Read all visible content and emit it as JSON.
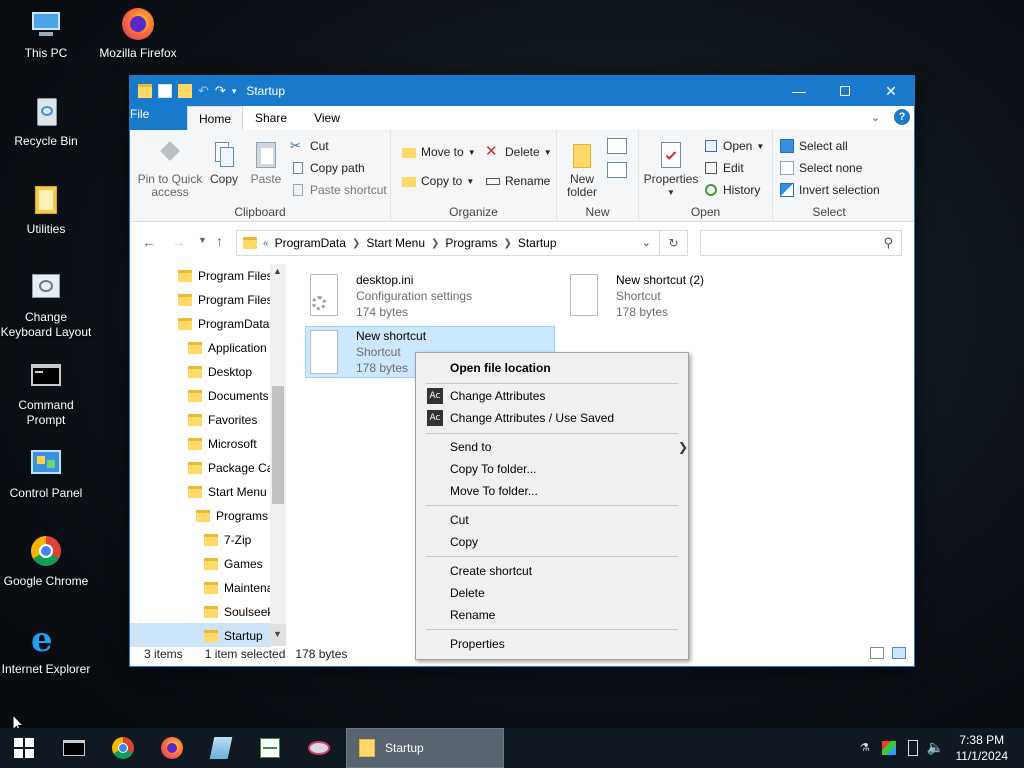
{
  "desktop": {
    "icons": [
      {
        "label": "This PC",
        "icon": "computer-icon"
      },
      {
        "label": "Mozilla Firefox",
        "icon": "firefox-icon"
      },
      {
        "label": "Recycle Bin",
        "icon": "recycle-bin-icon"
      },
      {
        "label": "Utilities",
        "icon": "folder-icon"
      },
      {
        "label": "Change Keyboard Layout",
        "icon": "keyboard-icon"
      },
      {
        "label": "Command Prompt",
        "icon": "terminal-icon"
      },
      {
        "label": "Control Panel",
        "icon": "control-panel-icon"
      },
      {
        "label": "Google Chrome",
        "icon": "chrome-icon"
      },
      {
        "label": "Internet Explorer",
        "icon": "ie-icon"
      }
    ]
  },
  "window": {
    "title": "Startup",
    "tabs": [
      "File",
      "Home",
      "Share",
      "View"
    ],
    "ribbon": {
      "clipboard": {
        "pin": "Pin to Quick access",
        "copy": "Copy",
        "paste": "Paste",
        "cut": "Cut",
        "copy_path": "Copy path",
        "paste_shortcut": "Paste shortcut",
        "label": "Clipboard"
      },
      "organize": {
        "move_to": "Move to",
        "copy_to": "Copy to",
        "delete": "Delete",
        "rename": "Rename",
        "label": "Organize"
      },
      "new": {
        "new_folder": "New folder",
        "label": "New"
      },
      "open": {
        "properties": "Properties",
        "open": "Open",
        "edit": "Edit",
        "history": "History",
        "label": "Open"
      },
      "select": {
        "select_all": "Select all",
        "select_none": "Select none",
        "invert": "Invert selection",
        "label": "Select"
      }
    },
    "address": {
      "prefix": "«",
      "crumbs": [
        "ProgramData",
        "Start Menu",
        "Programs",
        "Startup"
      ]
    },
    "nav": [
      {
        "label": "Program Files",
        "indent": 0
      },
      {
        "label": "Program Files",
        "indent": 0
      },
      {
        "label": "ProgramData",
        "indent": 0
      },
      {
        "label": "Application",
        "indent": 1
      },
      {
        "label": "Desktop",
        "indent": 1
      },
      {
        "label": "Documents",
        "indent": 1
      },
      {
        "label": "Favorites",
        "indent": 1
      },
      {
        "label": "Microsoft",
        "indent": 1
      },
      {
        "label": "Package Ca",
        "indent": 1
      },
      {
        "label": "Start Menu",
        "indent": 1
      },
      {
        "label": "Programs",
        "indent": 2
      },
      {
        "label": "7-Zip",
        "indent": 3
      },
      {
        "label": "Games",
        "indent": 3
      },
      {
        "label": "Maintena",
        "indent": 3
      },
      {
        "label": "Soulseek",
        "indent": 3
      },
      {
        "label": "Startup",
        "indent": 3
      }
    ],
    "files": [
      {
        "name": "desktop.ini",
        "type": "Configuration settings",
        "size": "174 bytes"
      },
      {
        "name": "New shortcut (2)",
        "type": "Shortcut",
        "size": "178 bytes"
      },
      {
        "name": "New shortcut",
        "type": "Shortcut",
        "size": "178 bytes"
      }
    ],
    "status": {
      "count": "3 items",
      "selected": "1 item selected",
      "size": "178 bytes"
    }
  },
  "context_menu": {
    "items": [
      "Open file location",
      "Change Attributes",
      "Change Attributes / Use Saved",
      "Send to",
      "Copy To folder...",
      "Move To folder...",
      "Cut",
      "Copy",
      "Create shortcut",
      "Delete",
      "Rename",
      "Properties"
    ],
    "ac_badge": "Ac"
  },
  "taskbar": {
    "active_label": "Startup",
    "time": "7:38 PM",
    "date": "11/1/2024"
  }
}
